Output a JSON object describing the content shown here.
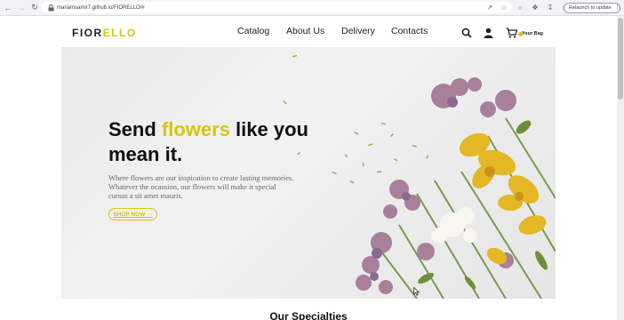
{
  "browser": {
    "url": "mariamsamir7.github.io/FIORELLO/#",
    "relaunch_label": "Relaunch to update",
    "avatar_initial": "M"
  },
  "site": {
    "logo_part1": "FIOR",
    "logo_part2": "ELLO",
    "nav": [
      "Catalog",
      "About Us",
      "Delivery",
      "Contacts"
    ],
    "bag_label": "Your Bag",
    "accent_color": "#d8c414"
  },
  "hero": {
    "title_part1": "Send ",
    "title_accent": "flowers",
    "title_part2": " like you mean it.",
    "description": "Where flowers are our inspiration to create lasting memories. Whatever the ocassion, our flowers will make it special cursus a sit amet mauris.",
    "button_label": "SHOP NOW →"
  },
  "section": {
    "title": "Our Specialties"
  }
}
